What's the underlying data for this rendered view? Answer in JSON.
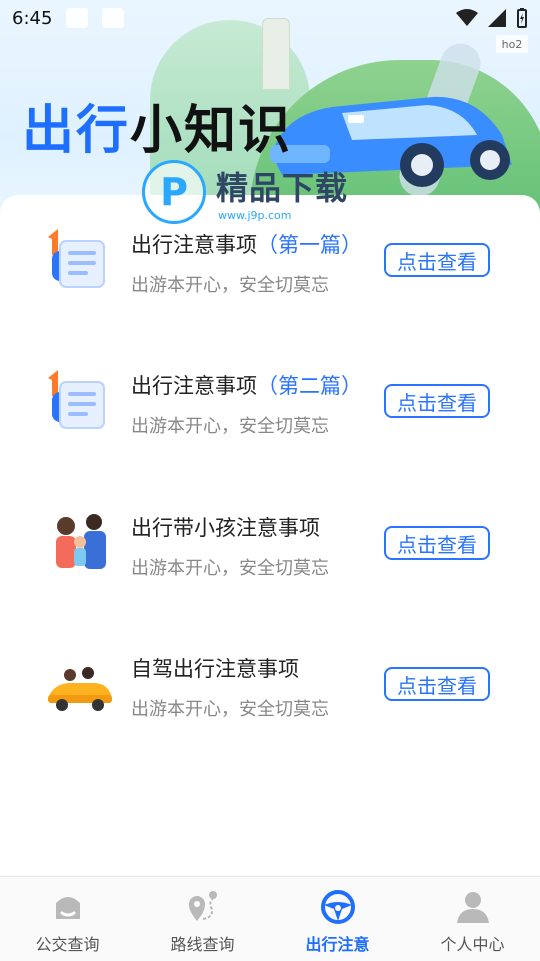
{
  "status_bar": {
    "time": "6:45"
  },
  "banner": {
    "title_part1": "出行",
    "title_part2": "小知识",
    "sign_text": "ho2",
    "watermark_title": "精品下载",
    "watermark_url": "www.j9p.com",
    "watermark_logo": "P"
  },
  "items": [
    {
      "title": "出行注意事项",
      "title_suffix": "（第一篇）",
      "subtitle": "出游本开心，安全切莫忘",
      "button": "点击查看",
      "icon": "document-icon"
    },
    {
      "title": "出行注意事项",
      "title_suffix": "（第二篇）",
      "subtitle": "出游本开心，安全切莫忘",
      "button": "点击查看",
      "icon": "document-icon"
    },
    {
      "title": "出行带小孩注意事项",
      "title_suffix": "",
      "subtitle": "出游本开心，安全切莫忘",
      "button": "点击查看",
      "icon": "family-icon"
    },
    {
      "title": "自驾出行注意事项",
      "title_suffix": "",
      "subtitle": "出游本开心，安全切莫忘",
      "button": "点击查看",
      "icon": "convertible-car-icon"
    }
  ],
  "tabs": [
    {
      "label": "公交查询",
      "icon": "bus-stop-icon",
      "active": false
    },
    {
      "label": "路线查询",
      "icon": "route-pin-icon",
      "active": false
    },
    {
      "label": "出行注意",
      "icon": "steering-wheel-icon",
      "active": true
    },
    {
      "label": "个人中心",
      "icon": "user-icon",
      "active": false
    }
  ],
  "colors": {
    "accent": "#1f6fff",
    "button_border": "#2a74ff",
    "subtitle": "#888888"
  }
}
